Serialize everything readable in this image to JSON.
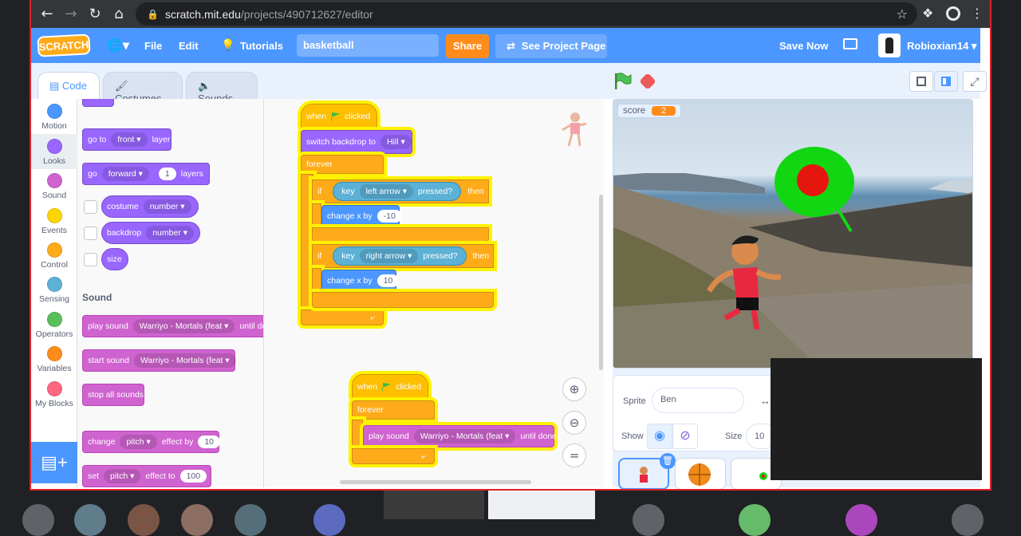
{
  "browser": {
    "url_host": "scratch.mit.edu",
    "url_path": "/projects/490712627/editor"
  },
  "menubar": {
    "logo": "SCRATCH",
    "file": "File",
    "edit": "Edit",
    "tutorials": "Tutorials",
    "project_title": "basketball",
    "share": "Share",
    "see_project": "See Project Page",
    "save_now": "Save Now",
    "username": "Robioxian14"
  },
  "tabs": {
    "code": "Code",
    "costumes": "Costumes",
    "sounds": "Sounds"
  },
  "categories": [
    {
      "label": "Motion",
      "color": "#4c97ff"
    },
    {
      "label": "Looks",
      "color": "#9966ff"
    },
    {
      "label": "Sound",
      "color": "#cf63cf"
    },
    {
      "label": "Events",
      "color": "#ffd500"
    },
    {
      "label": "Control",
      "color": "#ffab19"
    },
    {
      "label": "Sensing",
      "color": "#5cb1d6"
    },
    {
      "label": "Operators",
      "color": "#59c059"
    },
    {
      "label": "Variables",
      "color": "#ff8c1a"
    },
    {
      "label": "My Blocks",
      "color": "#ff6680"
    }
  ],
  "palette": {
    "goto_a": "go to",
    "goto_drop": "front",
    "goto_b": "layer",
    "go_a": "go",
    "go_drop": "forward",
    "go_num": "1",
    "go_b": "layers",
    "costume": "costume",
    "costume_drop": "number",
    "backdrop": "backdrop",
    "backdrop_drop": "number",
    "size": "size",
    "sound_heading": "Sound",
    "play_sound": "play sound",
    "play_sound_drop": "Warriyo - Mortals (feat",
    "play_sound_end": "until done",
    "start_sound": "start sound",
    "start_sound_drop": "Warriyo - Mortals (feat",
    "stop_all": "stop all sounds",
    "change": "change",
    "change_drop": "pitch",
    "change_mid": "effect by",
    "change_num": "10",
    "set": "set",
    "set_drop": "pitch",
    "set_mid": "effect to",
    "set_num": "100"
  },
  "script1": {
    "when": "when",
    "clicked": "clicked",
    "switch_backdrop": "switch backdrop to",
    "backdrop_val": "Hill",
    "forever": "forever",
    "if1": "if",
    "key1": "key",
    "key1_val": "left arrow",
    "pressed1": "pressed?",
    "then1": "then",
    "change1": "change x by",
    "change1_val": "-10",
    "if2": "if",
    "key2": "key",
    "key2_val": "right arrow",
    "pressed2": "pressed?",
    "then2": "then",
    "change2": "change x by",
    "change2_val": "10"
  },
  "script2": {
    "when": "when",
    "clicked": "clicked",
    "forever": "forever",
    "play_sound": "play sound",
    "sound_val": "Warriyo - Mortals (feat",
    "until_done": "until done"
  },
  "stage": {
    "monitor_label": "score",
    "monitor_value": "2"
  },
  "sprite_info": {
    "sprite_label": "Sprite",
    "sprite_name": "Ben",
    "show_label": "Show",
    "size_label": "Size",
    "size_value": "10"
  }
}
